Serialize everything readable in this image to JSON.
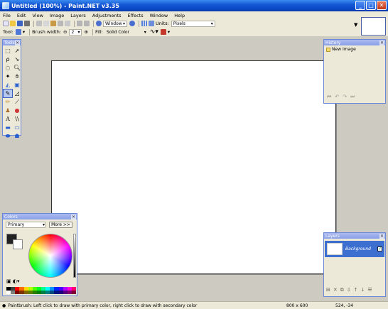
{
  "window": {
    "title": "Untitled (100%) - Paint.NET v3.35"
  },
  "menu": [
    "File",
    "Edit",
    "View",
    "Image",
    "Layers",
    "Adjustments",
    "Effects",
    "Window",
    "Help"
  ],
  "toolbar": {
    "window_combo": "Window",
    "units_label": "Units:",
    "units_value": "Pixels",
    "tool_label": "Tool:",
    "brush_width_label": "Brush width:",
    "brush_width_value": "2",
    "fill_label": "Fill:",
    "fill_value": "Solid Color"
  },
  "tools_panel": {
    "title": "Tools"
  },
  "history_panel": {
    "title": "History",
    "entry": "New Image"
  },
  "colors_panel": {
    "title": "Colors",
    "selector": "Primary",
    "more_button": "More >>"
  },
  "layers_panel": {
    "title": "Layers",
    "layer_name": "Background"
  },
  "status": {
    "hint": "Paintbrush: Left click to draw with primary color, right click to draw with secondary color",
    "image_size": "800 x 600",
    "cursor_pos": "524, -34"
  },
  "colors": {
    "accent": "#0a46c4",
    "workspace": "#cdcac1",
    "panel": "#ece9d8"
  }
}
